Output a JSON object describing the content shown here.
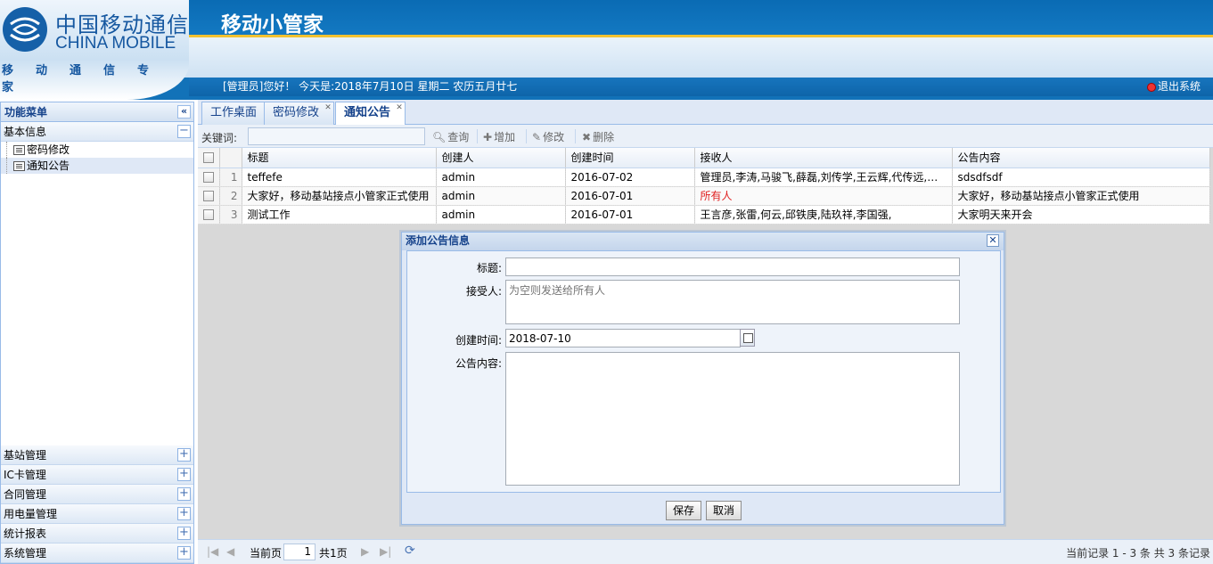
{
  "header": {
    "logo_cn": "中国移动通信",
    "logo_en": "CHINA MOBILE",
    "logo_slogan": "移动通信专家",
    "app_title": "移动小管家",
    "greeting": "[管理员]您好！  今天是:2018年7月10日  星期二  农历五月廿七",
    "logout_label": "退出系统"
  },
  "sidebar": {
    "title": "功能菜单",
    "collapse_glyph": "«",
    "open_section": {
      "label": "基本信息",
      "items": [
        {
          "label": "密码修改"
        },
        {
          "label": "通知公告"
        }
      ]
    },
    "sections": [
      {
        "label": "基站管理"
      },
      {
        "label": "IC卡管理"
      },
      {
        "label": "合同管理"
      },
      {
        "label": "用电量管理"
      },
      {
        "label": "统计报表"
      },
      {
        "label": "系统管理"
      }
    ]
  },
  "tabs": [
    {
      "label": "工作桌面"
    },
    {
      "label": "密码修改"
    },
    {
      "label": "通知公告"
    }
  ],
  "toolbar": {
    "keyword_label": "关键词:",
    "search_label": "查询",
    "add_label": "增加",
    "edit_label": "修改",
    "delete_label": "删除"
  },
  "grid": {
    "columns": [
      "标题",
      "创建人",
      "创建时间",
      "接收人",
      "公告内容"
    ],
    "rows": [
      {
        "num": "1",
        "title": "teffefe",
        "creator": "admin",
        "date": "2016-07-02",
        "recipients": "管理员,李涛,马骏飞,薛磊,刘传学,王云辉,代传远,栾...",
        "content": "sdsdfsdf"
      },
      {
        "num": "2",
        "title": "大家好，移动基站接点小管家正式使用",
        "creator": "admin",
        "date": "2016-07-01",
        "recipients": "所有人",
        "content": "大家好，移动基站接点小管家正式使用"
      },
      {
        "num": "3",
        "title": "测试工作",
        "creator": "admin",
        "date": "2016-07-01",
        "recipients": "王言彦,张雷,何云,邱铁庚,陆玖祥,李国强,",
        "content": "大家明天来开会"
      }
    ]
  },
  "pager": {
    "current_label": "当前页",
    "page_value": "1",
    "total_label": "共1页",
    "record_info": "当前记录 1 - 3 条 共 3 条记录"
  },
  "dialog": {
    "title": "添加公告信息",
    "title_label": "标题:",
    "title_value": "",
    "receiver_label": "接受人:",
    "receiver_placeholder": "为空则发送给所有人",
    "date_label": "创建时间:",
    "date_value": "2018-07-10",
    "content_label": "公告内容:",
    "content_value": "",
    "save_label": "保存",
    "cancel_label": "取消"
  },
  "colors": {
    "header_blue": "#1272b8",
    "accent_gold": "#f2c230",
    "panel_border": "#99bbe8",
    "highlight_red": "#e02020"
  }
}
